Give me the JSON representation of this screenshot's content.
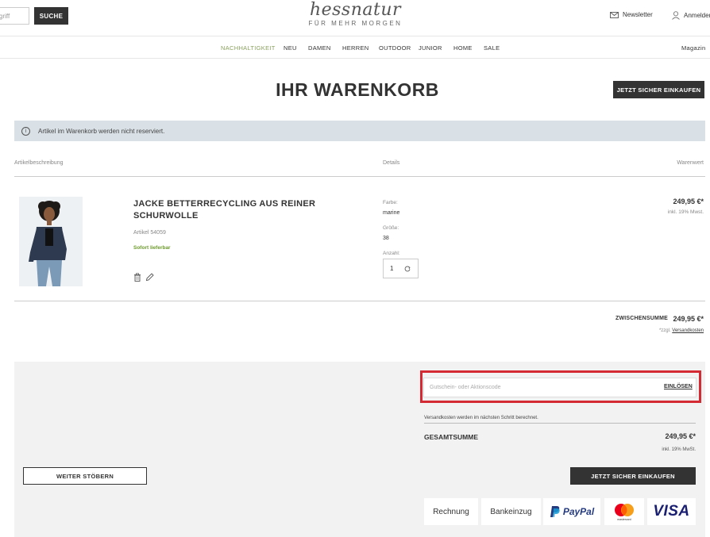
{
  "header": {
    "search_placeholder": "griff",
    "search_button": "SUCHE",
    "logo_word": "hessnatur",
    "logo_tagline": "FÜR MEHR MORGEN",
    "newsletter_label": "Newsletter",
    "login_label": "Anmelden"
  },
  "nav": {
    "items": [
      "NACHHALTIGKEIT",
      "NEU",
      "DAMEN",
      "HERREN",
      "OUTDOOR",
      "JUNIOR",
      "HOME",
      "SALE"
    ],
    "magazin": "Magazin"
  },
  "cart": {
    "title": "IHR WARENKORB",
    "checkout_top": "JETZT SICHER EINKAUFEN",
    "notice": "Artikel im Warenkorb werden nicht reserviert.",
    "columns": {
      "description": "Artikelbeschreibung",
      "details": "Details",
      "value": "Warenwert"
    }
  },
  "product": {
    "name": "JACKE BETTERRECYCLING AUS REINER SCHURWOLLE",
    "sku": "Artikel 54059",
    "availability": "Sofort lieferbar",
    "color_label": "Farbe:",
    "color_value": "marine",
    "size_label": "Größe:",
    "size_value": "38",
    "qty_label": "Anzahl:",
    "qty_value": "1",
    "price": "249,95 €*",
    "price_tax": "inkl. 19% Mwst."
  },
  "subtotal": {
    "label": "ZWISCHENSUMME",
    "value": "249,95 €*",
    "note_prefix": "*zzgl.",
    "note_link": "Versandkosten"
  },
  "summary": {
    "coupon_placeholder": "Gutschein- oder Aktionscode",
    "coupon_button": "EINLÖSEN",
    "shipping_note": "Versandkosten werden im nächsten Schritt berechnet.",
    "total_label": "GESAMTSUMME",
    "total_value": "249,95 €*",
    "total_tax": "inkl. 19% MwSt.",
    "continue_button": "WEITER STÖBERN",
    "checkout_button": "JETZT SICHER EINKAUFEN"
  },
  "payments": [
    "Rechnung",
    "Bankeinzug",
    "PayPal",
    "mastercard",
    "VISA"
  ],
  "colors": {
    "dark": "#333333",
    "accent_green": "#8aa25e",
    "notice_bg": "#d9e1e6",
    "highlight_red": "#d42a33",
    "paypal_dark": "#253b80",
    "paypal_light": "#179bd7",
    "visa_blue": "#1a1f71"
  }
}
